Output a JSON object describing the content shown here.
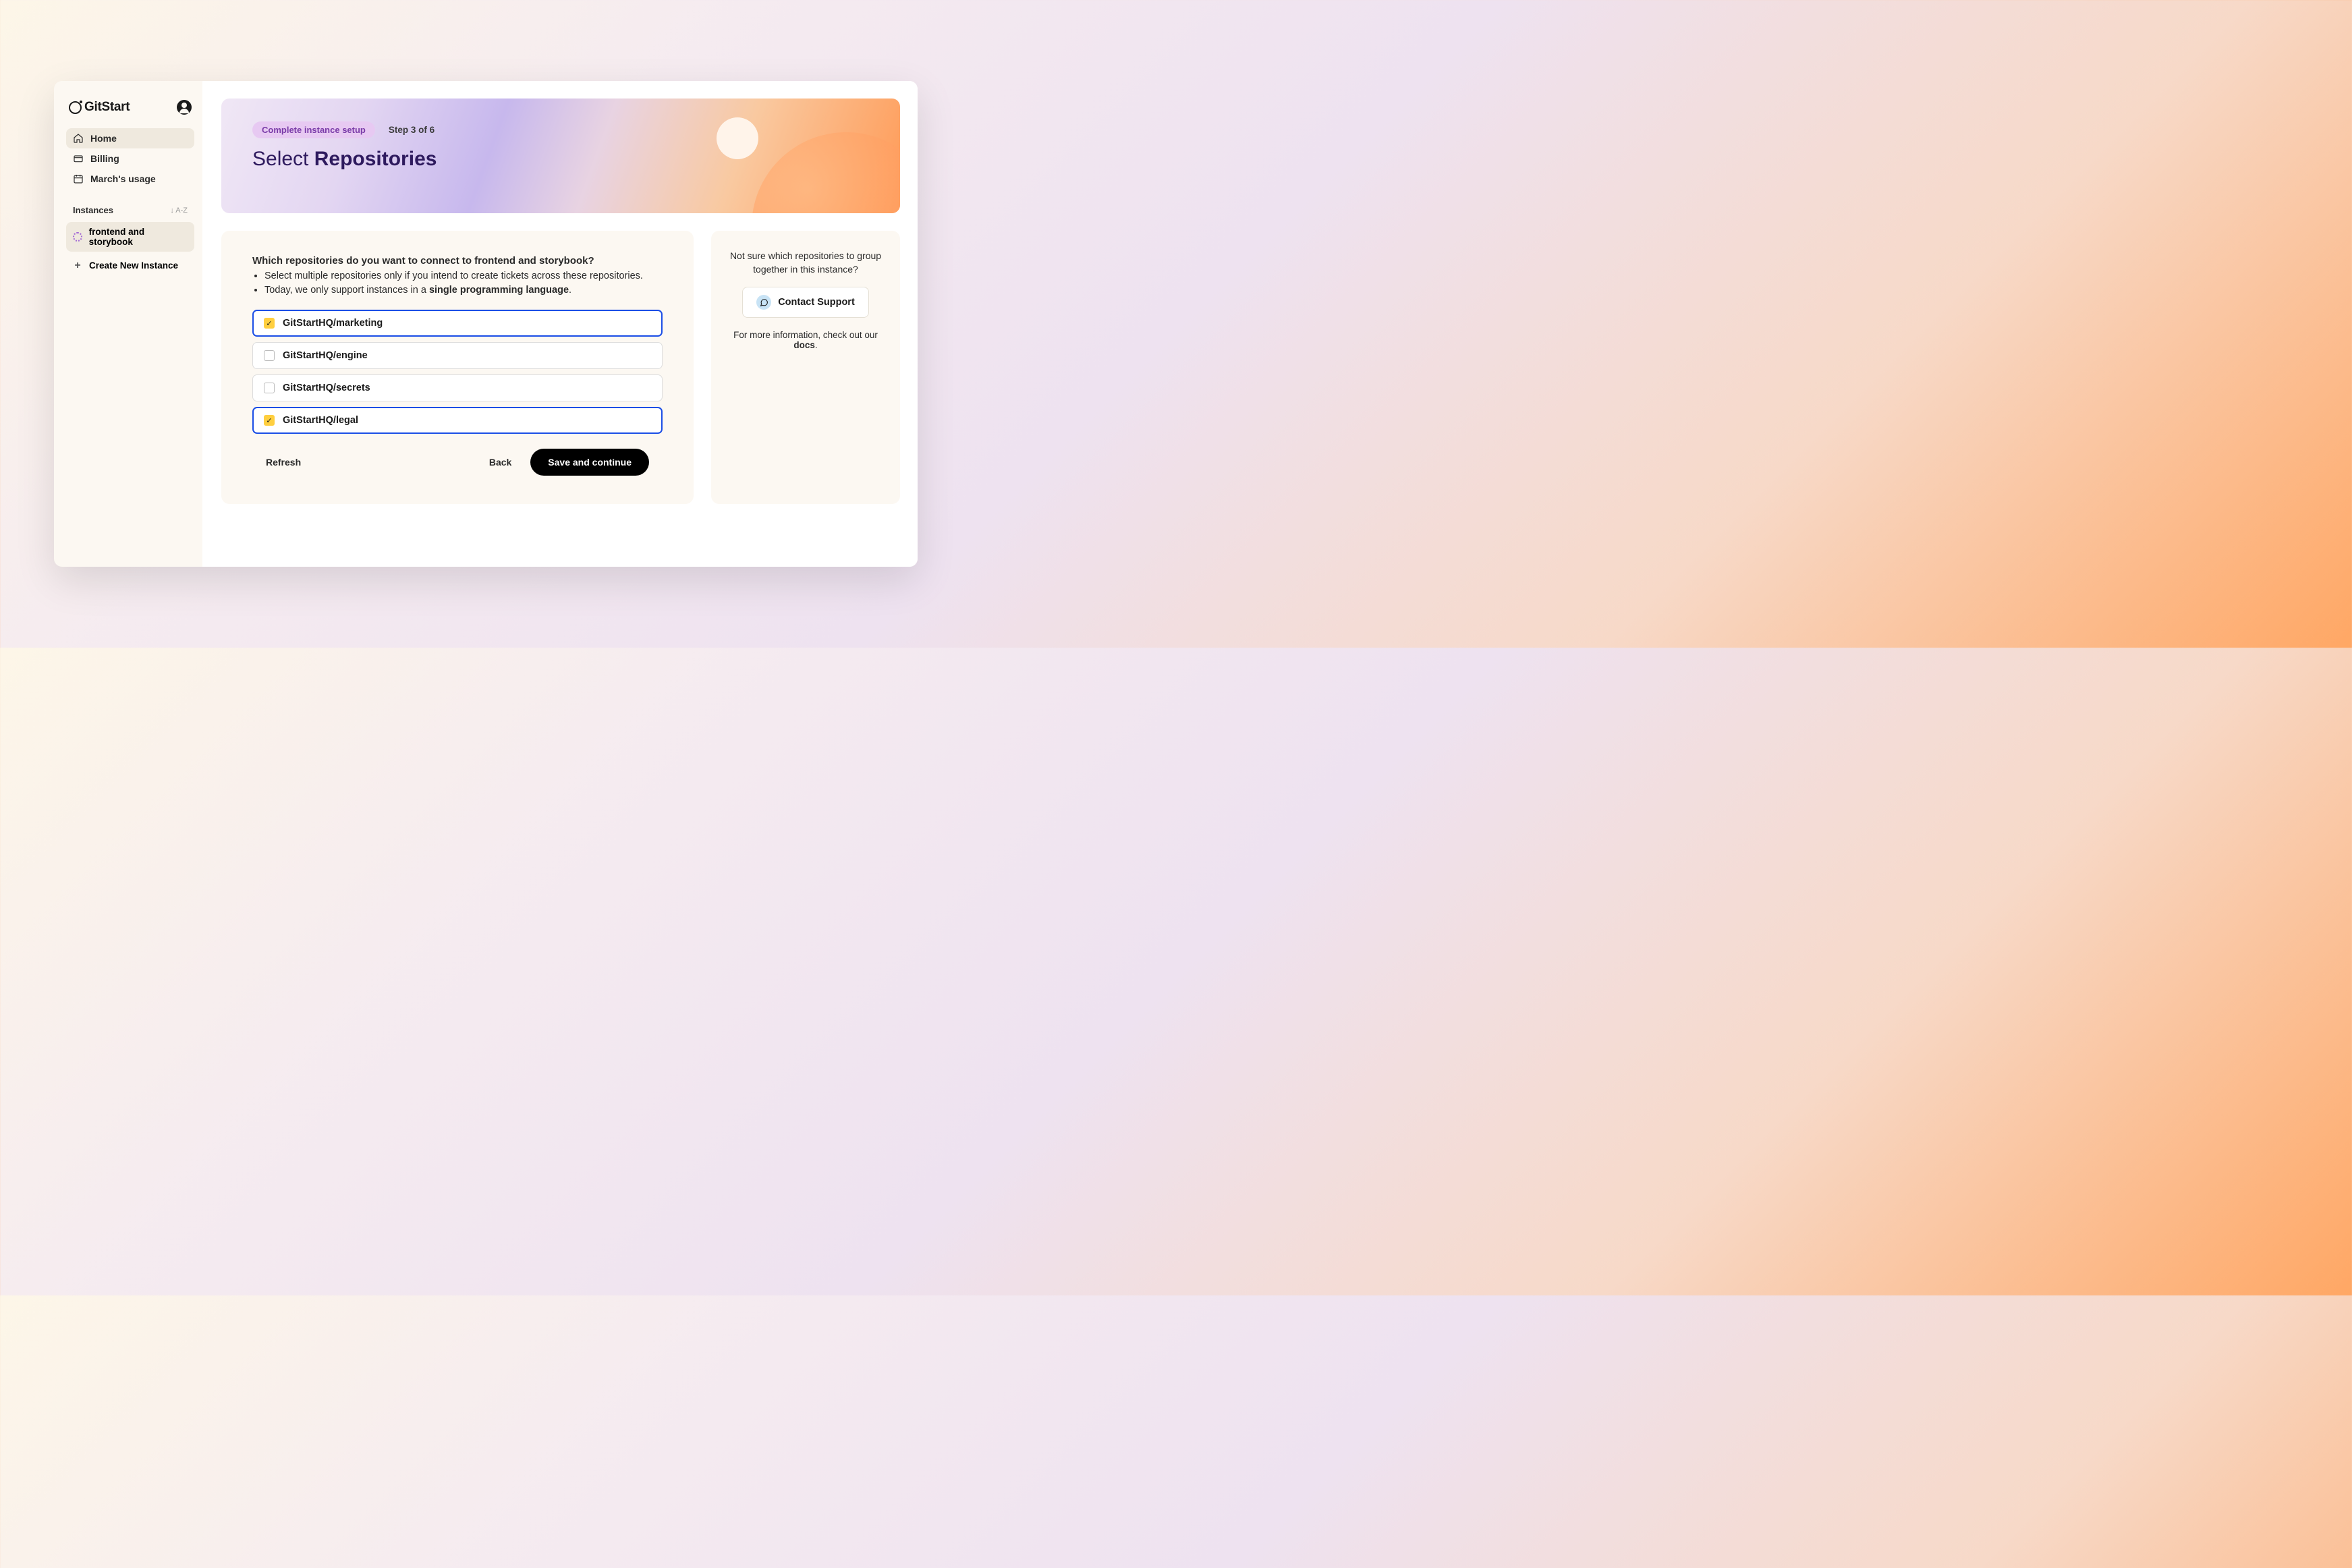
{
  "brand": "GitStart",
  "sidebar": {
    "nav": [
      {
        "label": "Home",
        "icon": "home",
        "active": true
      },
      {
        "label": "Billing",
        "icon": "billing",
        "active": false
      },
      {
        "label": "March's usage",
        "icon": "calendar",
        "active": false
      }
    ],
    "instances_header": "Instances",
    "sort": "↓ A-Z",
    "instances": [
      {
        "label": "frontend and storybook",
        "active": true
      }
    ],
    "create_label": "Create New Instance"
  },
  "hero": {
    "badge": "Complete instance setup",
    "step": "Step 3 of 6",
    "title_light": "Select ",
    "title_bold": "Repositories"
  },
  "main": {
    "question": "Which repositories do you want to connect to frontend and storybook?",
    "bullet1": "Select multiple repositories only if you intend to create tickets across these repositories.",
    "bullet2_prefix": "Today, we only support instances in a ",
    "bullet2_bold": "single programming language",
    "bullet2_suffix": ".",
    "repos": [
      {
        "label": "GitStartHQ/marketing",
        "selected": true
      },
      {
        "label": "GitStartHQ/engine",
        "selected": false
      },
      {
        "label": "GitStartHQ/secrets",
        "selected": false
      },
      {
        "label": "GitStartHQ/legal",
        "selected": true
      }
    ],
    "refresh": "Refresh",
    "back": "Back",
    "save": "Save and continue"
  },
  "aside": {
    "help_text": "Not sure which repositories to group together in this instance?",
    "support_label": "Contact Support",
    "docs_prefix": "For more information, check out our ",
    "docs_bold": "docs",
    "docs_suffix": "."
  }
}
